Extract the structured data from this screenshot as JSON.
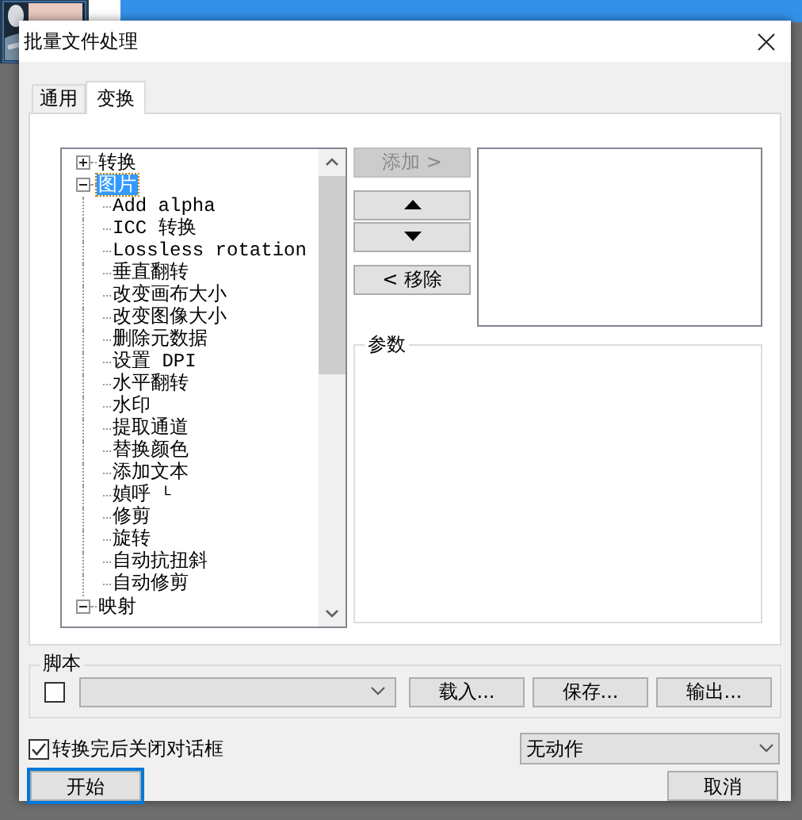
{
  "window": {
    "title": "批量文件处理"
  },
  "tabs": [
    {
      "label": "通用",
      "selected": false
    },
    {
      "label": "变换",
      "selected": true
    }
  ],
  "tree": [
    {
      "label": "转换",
      "expanded": false,
      "selected": false
    },
    {
      "label": "图片",
      "expanded": true,
      "selected": true,
      "children": [
        {
          "label": "Add alpha"
        },
        {
          "label": "ICC 转换"
        },
        {
          "label": "Lossless rotation"
        },
        {
          "label": "垂直翻转"
        },
        {
          "label": "改变画布大小"
        },
        {
          "label": "改变图像大小"
        },
        {
          "label": "删除元数据"
        },
        {
          "label": "设置 DPI"
        },
        {
          "label": "水平翻转"
        },
        {
          "label": "水印"
        },
        {
          "label": "提取通道"
        },
        {
          "label": "替换颜色"
        },
        {
          "label": "添加文本"
        },
        {
          "label": "媜呼 ᴸ"
        },
        {
          "label": "修剪"
        },
        {
          "label": "旋转"
        },
        {
          "label": "自动抗扭斜"
        },
        {
          "label": "自动修剪"
        }
      ]
    },
    {
      "label": "映射",
      "expanded": true,
      "selected": false
    }
  ],
  "side_buttons": [
    {
      "kind": "text",
      "label": "添加 >",
      "disabled": true
    },
    {
      "kind": "up",
      "disabled": false
    },
    {
      "kind": "down",
      "disabled": false
    },
    {
      "kind": "text",
      "label": "< 移除",
      "disabled": false
    }
  ],
  "params": {
    "label": "参数"
  },
  "script": {
    "label": "脚本",
    "checked": false,
    "buttons": [
      "载入...",
      "保存...",
      "输出..."
    ]
  },
  "close_after": {
    "label": "转换完后关闭对话框",
    "checked": true
  },
  "action_select": {
    "value": "无动作"
  },
  "footer_buttons": [
    {
      "label": "开始",
      "default": true
    },
    {
      "label": "取消",
      "default": false
    }
  ]
}
